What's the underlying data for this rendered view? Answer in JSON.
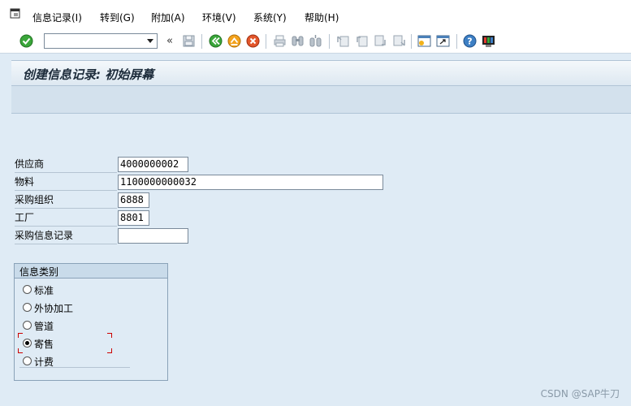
{
  "menu": {
    "items": [
      "信息记录(I)",
      "转到(G)",
      "附加(A)",
      "环境(V)",
      "系统(Y)",
      "帮助(H)"
    ]
  },
  "toolbar": {
    "command_field_value": "",
    "nav_back_glyph": "«"
  },
  "title": "创建信息记录: 初始屏幕",
  "form": {
    "vendor_label": "供应商",
    "vendor_value": "4000000002",
    "material_label": "物料",
    "material_value": "1100000000032",
    "purch_org_label": "采购组织",
    "purch_org_value": "6888",
    "plant_label": "工厂",
    "plant_value": "8801",
    "info_record_label": "采购信息记录",
    "info_record_value": ""
  },
  "info_category": {
    "title": "信息类别",
    "options": [
      "标准",
      "外协加工",
      "管道",
      "寄售",
      "计费"
    ],
    "selected": "寄售"
  },
  "watermark": "CSDN @SAP牛刀",
  "colors": {
    "background": "#dfebf5",
    "accent_green": "#2e9b2e",
    "accent_orange": "#f09a1a",
    "focus_red": "#cc0000"
  }
}
